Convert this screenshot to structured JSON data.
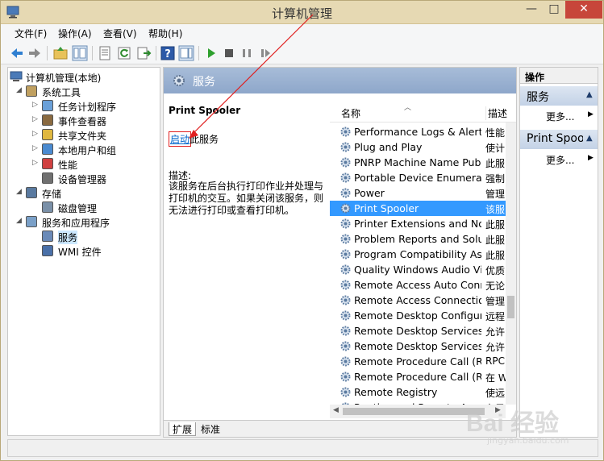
{
  "window": {
    "title": "计算机管理",
    "minimize": "—",
    "maximize": "□",
    "close": "✕"
  },
  "menu": [
    {
      "label": "文件(F)"
    },
    {
      "label": "操作(A)"
    },
    {
      "label": "查看(V)"
    },
    {
      "label": "帮助(H)"
    }
  ],
  "toolbar_icons": [
    "back-icon",
    "forward-icon",
    "up-folder-icon",
    "show-tree-icon",
    "properties-icon",
    "refresh-icon",
    "export-icon",
    "help-icon",
    "action-pane-icon",
    "play-icon",
    "stop-icon",
    "pause-icon",
    "restart-icon"
  ],
  "tree": {
    "root": "计算机管理(本地)",
    "items": [
      {
        "label": "系统工具",
        "level": 1,
        "arrow": "◢"
      },
      {
        "label": "任务计划程序",
        "level": 2,
        "arrow": "▷"
      },
      {
        "label": "事件查看器",
        "level": 2,
        "arrow": "▷"
      },
      {
        "label": "共享文件夹",
        "level": 2,
        "arrow": "▷"
      },
      {
        "label": "本地用户和组",
        "level": 2,
        "arrow": "▷"
      },
      {
        "label": "性能",
        "level": 2,
        "arrow": "▷"
      },
      {
        "label": "设备管理器",
        "level": 2,
        "arrow": ""
      },
      {
        "label": "存储",
        "level": 1,
        "arrow": "◢"
      },
      {
        "label": "磁盘管理",
        "level": 2,
        "arrow": ""
      },
      {
        "label": "服务和应用程序",
        "level": 1,
        "arrow": "◢"
      },
      {
        "label": "服务",
        "level": 2,
        "arrow": ""
      },
      {
        "label": "WMI 控件",
        "level": 2,
        "arrow": ""
      }
    ]
  },
  "services_panel": {
    "header": "服务",
    "selected_name": "Print Spooler",
    "start_link": "启动",
    "start_rest": "此服务",
    "desc_label": "描述:",
    "description": "该服务在后台执行打印作业并处理与打印机的交互。如果关闭该服务，则无法进行打印或查看打印机。",
    "col_name": "名称",
    "col_desc": "描述",
    "tab_extended": "扩展",
    "tab_standard": "标准"
  },
  "services": [
    {
      "name": "Performance Logs & Alerts",
      "desc": "性能"
    },
    {
      "name": "Plug and Play",
      "desc": "使计"
    },
    {
      "name": "PNRP Machine Name Publication",
      "desc": "此服"
    },
    {
      "name": "Portable Device Enumerator",
      "desc": "强制"
    },
    {
      "name": "Power",
      "desc": "管理"
    },
    {
      "name": "Print Spooler",
      "desc": "该服"
    },
    {
      "name": "Printer Extensions and Notifications",
      "desc": "此服"
    },
    {
      "name": "Problem Reports and Solutions",
      "desc": "此服"
    },
    {
      "name": "Program Compatibility Assistant",
      "desc": "此服"
    },
    {
      "name": "Quality Windows Audio Video",
      "desc": "优质"
    },
    {
      "name": "Remote Access Auto Connection",
      "desc": "无论"
    },
    {
      "name": "Remote Access Connection Manager",
      "desc": "管理"
    },
    {
      "name": "Remote Desktop Configuration",
      "desc": "远程"
    },
    {
      "name": "Remote Desktop Services",
      "desc": "允许"
    },
    {
      "name": "Remote Desktop Services UserMode",
      "desc": "允许"
    },
    {
      "name": "Remote Procedure Call (RPC)",
      "desc": "RPC"
    },
    {
      "name": "Remote Procedure Call (RPC) Locator",
      "desc": "在 W"
    },
    {
      "name": "Remote Registry",
      "desc": "使远"
    },
    {
      "name": "Routing and Remote Access",
      "desc": "在局"
    }
  ],
  "actions": {
    "title": "操作",
    "section1": "服务",
    "section2": "Print Spooler",
    "more1": "更多...",
    "more2": "更多..."
  },
  "watermark": {
    "main": "Bai 经验",
    "sub": "jingyan.baidu.com"
  },
  "colors": {
    "title_bar": "#e6d9b3",
    "selection": "#3399ff",
    "header": "#8ea7ca",
    "close": "#c7463a",
    "annotation": "#e02020"
  }
}
